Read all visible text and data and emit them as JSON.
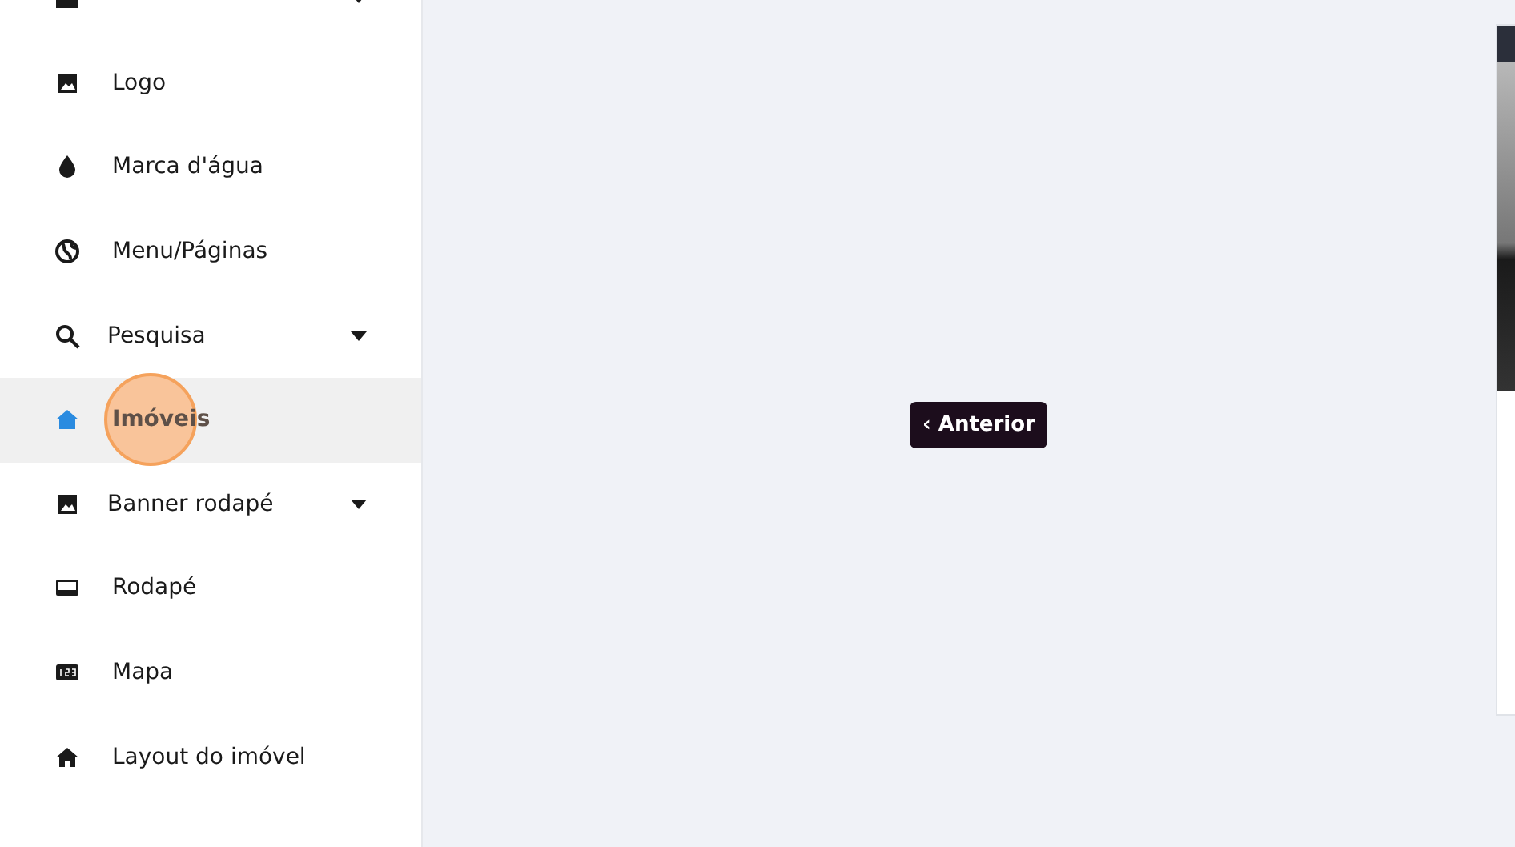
{
  "sidebar": {
    "items": [
      {
        "label": "Logo",
        "kind": "link",
        "selected": false
      },
      {
        "label": "Marca d'água",
        "kind": "link",
        "selected": false
      },
      {
        "label": "Menu/Páginas",
        "kind": "link",
        "selected": false
      },
      {
        "label": "Pesquisa",
        "kind": "group",
        "selected": false
      },
      {
        "label": "Imóveis",
        "kind": "link",
        "selected": true
      },
      {
        "label": "Banner rodapé",
        "kind": "group",
        "selected": false
      },
      {
        "label": "Rodapé",
        "kind": "link",
        "selected": false
      },
      {
        "label": "Mapa",
        "kind": "link",
        "selected": false
      },
      {
        "label": "Layout do imóvel",
        "kind": "link",
        "selected": false
      }
    ]
  },
  "main": {
    "previous_button": "‹ Anterior"
  }
}
